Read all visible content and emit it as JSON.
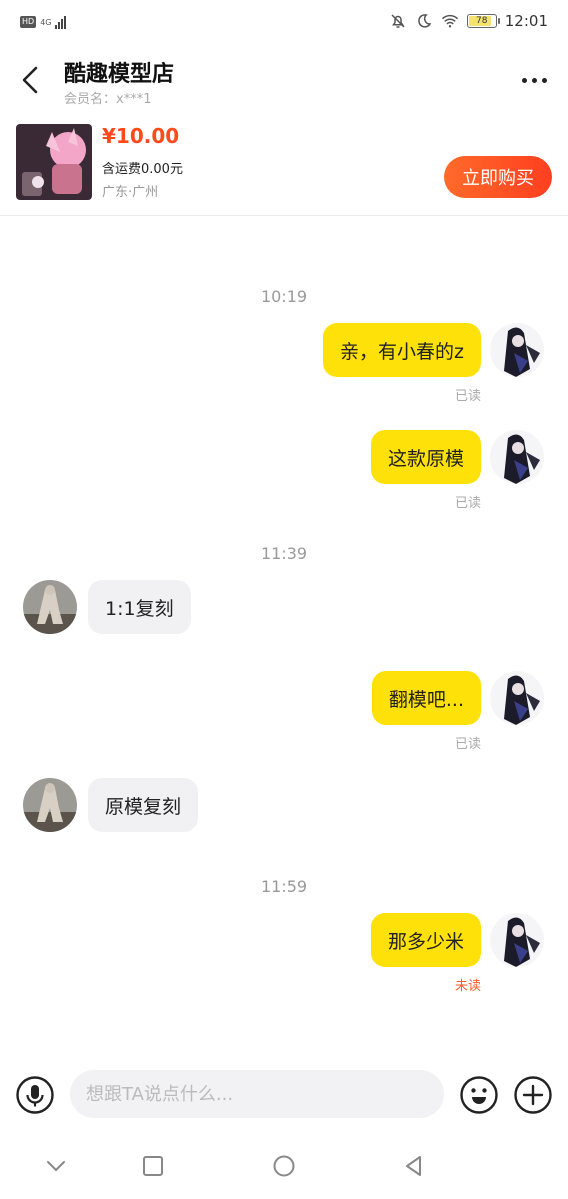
{
  "status_bar": {
    "hd": "HD",
    "network": "4G",
    "battery": "78",
    "battery_level": 0.78,
    "time": "12:01"
  },
  "header": {
    "shop_name": "酷趣模型店",
    "member": "会员名：x***1"
  },
  "product": {
    "price": "¥10.00",
    "shipping": "含运费0.00元",
    "location": "广东·广州",
    "buy_label": "立即购买"
  },
  "messages": [
    {
      "type": "time",
      "text": "10:19"
    },
    {
      "type": "me",
      "text": "亲，有小春的z",
      "status": "已读"
    },
    {
      "type": "me",
      "text": "这款原模",
      "status": "已读"
    },
    {
      "type": "time",
      "text": "11:39"
    },
    {
      "type": "them",
      "text": "1:1复刻"
    },
    {
      "type": "me",
      "text": "翻模吧...",
      "status": "已读"
    },
    {
      "type": "them",
      "text": "原模复刻"
    },
    {
      "type": "time",
      "text": "11:59"
    },
    {
      "type": "me",
      "text": "那多少米",
      "status": "未读"
    }
  ],
  "input": {
    "placeholder": "想跟TA说点什么..."
  },
  "icons": {
    "back": "back-arrow-icon",
    "more": "more-dots-icon",
    "mic": "microphone-icon",
    "emoji": "emoji-icon",
    "plus": "plus-icon"
  },
  "colors": {
    "accent": "#ff4a1f",
    "my_bubble": "#ffe10a",
    "their_bubble": "#f1f1f3",
    "unread": "#ff5a2a"
  }
}
